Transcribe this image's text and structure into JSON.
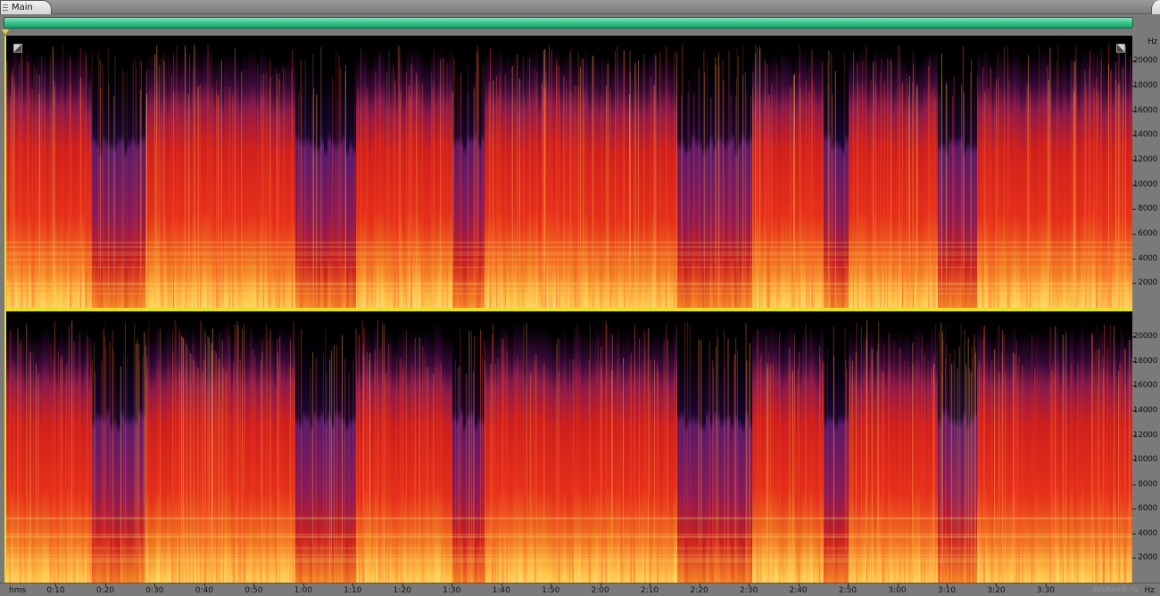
{
  "window": {
    "tab_label": "Main"
  },
  "colors": {
    "accent": "#33c48a",
    "divider": "#e6e02a",
    "spectrum_low": "#ffe066",
    "spectrum_mid": "#e0201a",
    "spectrum_high": "#5a1a6a"
  },
  "frequency_axis": {
    "unit": "Hz",
    "ticks": [
      "20000",
      "18000",
      "16000",
      "14000",
      "12000",
      "10000",
      "8000",
      "6000",
      "4000",
      "2000"
    ],
    "max_hz": 22050
  },
  "time_axis": {
    "unit": "hms",
    "ticks": [
      "0:10",
      "0:20",
      "0:30",
      "0:40",
      "0:50",
      "1:00",
      "1:10",
      "1:20",
      "1:30",
      "1:40",
      "1:50",
      "2:00",
      "2:10",
      "2:20",
      "2:30",
      "2:40",
      "2:50",
      "3:00",
      "3:10",
      "3:20",
      "3:30"
    ],
    "tick_seconds": [
      10,
      20,
      30,
      40,
      50,
      60,
      70,
      80,
      90,
      100,
      110,
      120,
      130,
      140,
      150,
      160,
      170,
      180,
      190,
      200,
      210
    ],
    "total_seconds": 227.5
  },
  "channels": [
    "top",
    "bottom"
  ],
  "watermark": "zvukovik.ru"
}
